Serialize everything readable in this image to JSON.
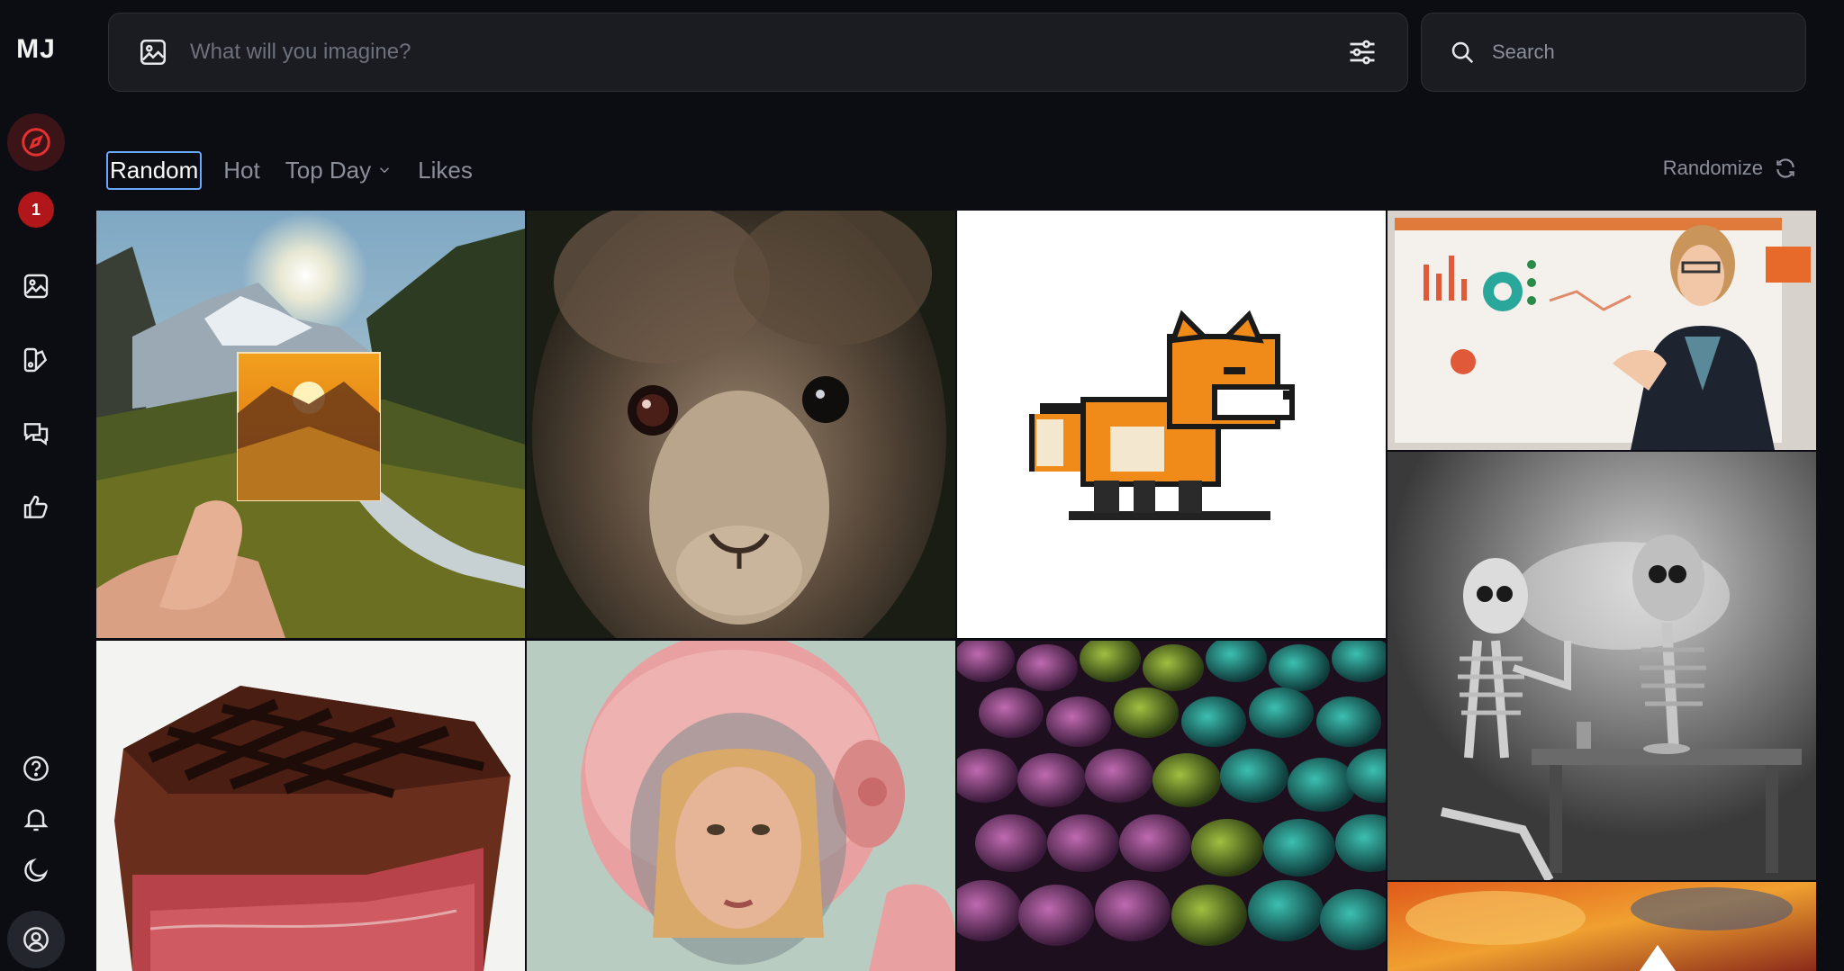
{
  "sidebar": {
    "logo": "MJ",
    "notification_count": "1",
    "icons": [
      "compass-icon",
      "image-icon",
      "palette-icon",
      "chat-icon",
      "thumbs-up-icon",
      "help-icon",
      "bell-icon",
      "moon-icon",
      "user-icon"
    ]
  },
  "prompt": {
    "placeholder": "What will you imagine?"
  },
  "search": {
    "placeholder": "Search"
  },
  "tabs": [
    {
      "label": "Random",
      "active": true
    },
    {
      "label": "Hot",
      "active": false
    },
    {
      "label": "Top Day",
      "active": false
    },
    {
      "label": "Likes",
      "active": false
    }
  ],
  "randomize_label": "Randomize",
  "colors": {
    "accent": "#e5312f",
    "background": "#0b0d12",
    "input_bg": "#1a1c22",
    "active_tab_border": "#6aa7ff"
  },
  "gallery": [
    {
      "subject": "hand-holding-photo-mountain-valley"
    },
    {
      "subject": "fluffy-alpaca-closeup"
    },
    {
      "subject": "pixel-art-fox"
    },
    {
      "subject": "woman-presenting-charts"
    },
    {
      "subject": "skeletons-smoking-at-table"
    },
    {
      "subject": "grilled-steak"
    },
    {
      "subject": "woman-pink-astronaut-helmet"
    },
    {
      "subject": "iridescent-dragon-scales"
    },
    {
      "subject": "fiery-sky"
    }
  ]
}
